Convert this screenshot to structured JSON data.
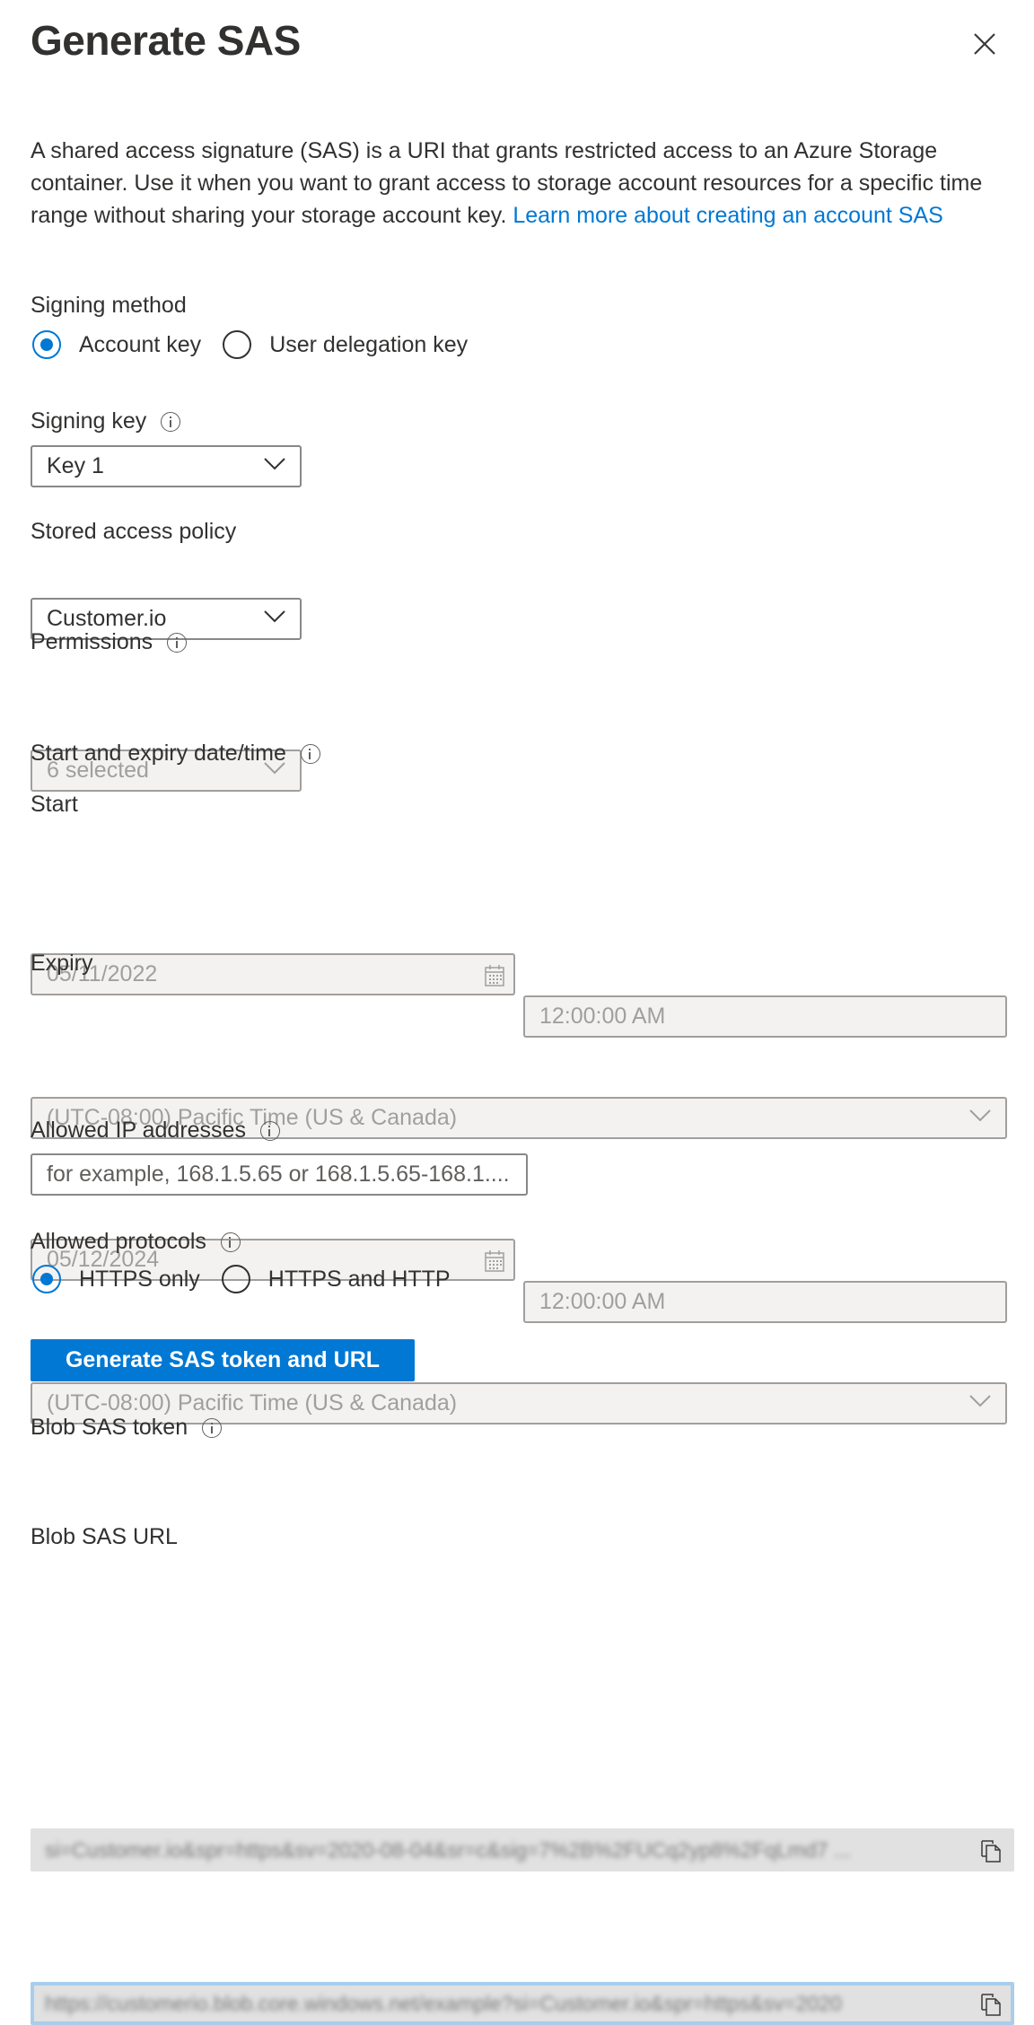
{
  "panel": {
    "title": "Generate SAS",
    "close_icon": "close-icon",
    "description": "A shared access signature (SAS) is a URI that grants restricted access to an Azure Storage container. Use it when you want to grant access to storage account resources for a specific time range without sharing your storage account key. ",
    "learn_more_link": "Learn more about creating an account SAS"
  },
  "signing_method": {
    "label": "Signing method",
    "options": [
      {
        "label": "Account key",
        "checked": true
      },
      {
        "label": "User delegation key",
        "checked": false
      }
    ]
  },
  "signing_key": {
    "label": "Signing key",
    "info_icon": "info-icon",
    "value": "Key 1"
  },
  "stored_access_policy": {
    "label": "Stored access policy",
    "value": "Customer.io"
  },
  "permissions": {
    "label": "Permissions",
    "info_icon": "info-icon",
    "value": "6 selected",
    "disabled": true
  },
  "date_time": {
    "label": "Start and expiry date/time",
    "info_icon": "info-icon",
    "start": {
      "label": "Start",
      "date": "05/11/2022",
      "time": "12:00:00 AM",
      "timezone": "(UTC-08:00) Pacific Time (US & Canada)"
    },
    "expiry": {
      "label": "Expiry",
      "date": "05/12/2024",
      "time": "12:00:00 AM",
      "timezone": "(UTC-08:00) Pacific Time (US & Canada)"
    }
  },
  "allowed_ip": {
    "label": "Allowed IP addresses",
    "info_icon": "info-icon",
    "placeholder": "for example, 168.1.5.65 or 168.1.5.65-168.1...."
  },
  "allowed_protocols": {
    "label": "Allowed protocols",
    "info_icon": "info-icon",
    "options": [
      {
        "label": "HTTPS only",
        "checked": true
      },
      {
        "label": "HTTPS and HTTP",
        "checked": false
      }
    ]
  },
  "generate_button": {
    "label": "Generate SAS token and URL"
  },
  "blob_sas_token": {
    "label": "Blob SAS token",
    "info_icon": "info-icon",
    "value": "si=Customer.io&spr=https&sv=2020-08-04&sr=c&sig=7%2B%2FUCq2yp8%2FqLmd7 ...",
    "copy_icon": "copy-icon"
  },
  "blob_sas_url": {
    "label": "Blob SAS URL",
    "value": "https://customerio.blob.core.windows.net/example?si=Customer.io&spr=https&sv=2020",
    "copy_icon": "copy-icon"
  },
  "colors": {
    "accent": "#0078d4",
    "text": "#323130",
    "disabled_bg": "#f3f2f1",
    "disabled_text": "#a19f9d",
    "url_highlight": "#a9cdeb"
  }
}
